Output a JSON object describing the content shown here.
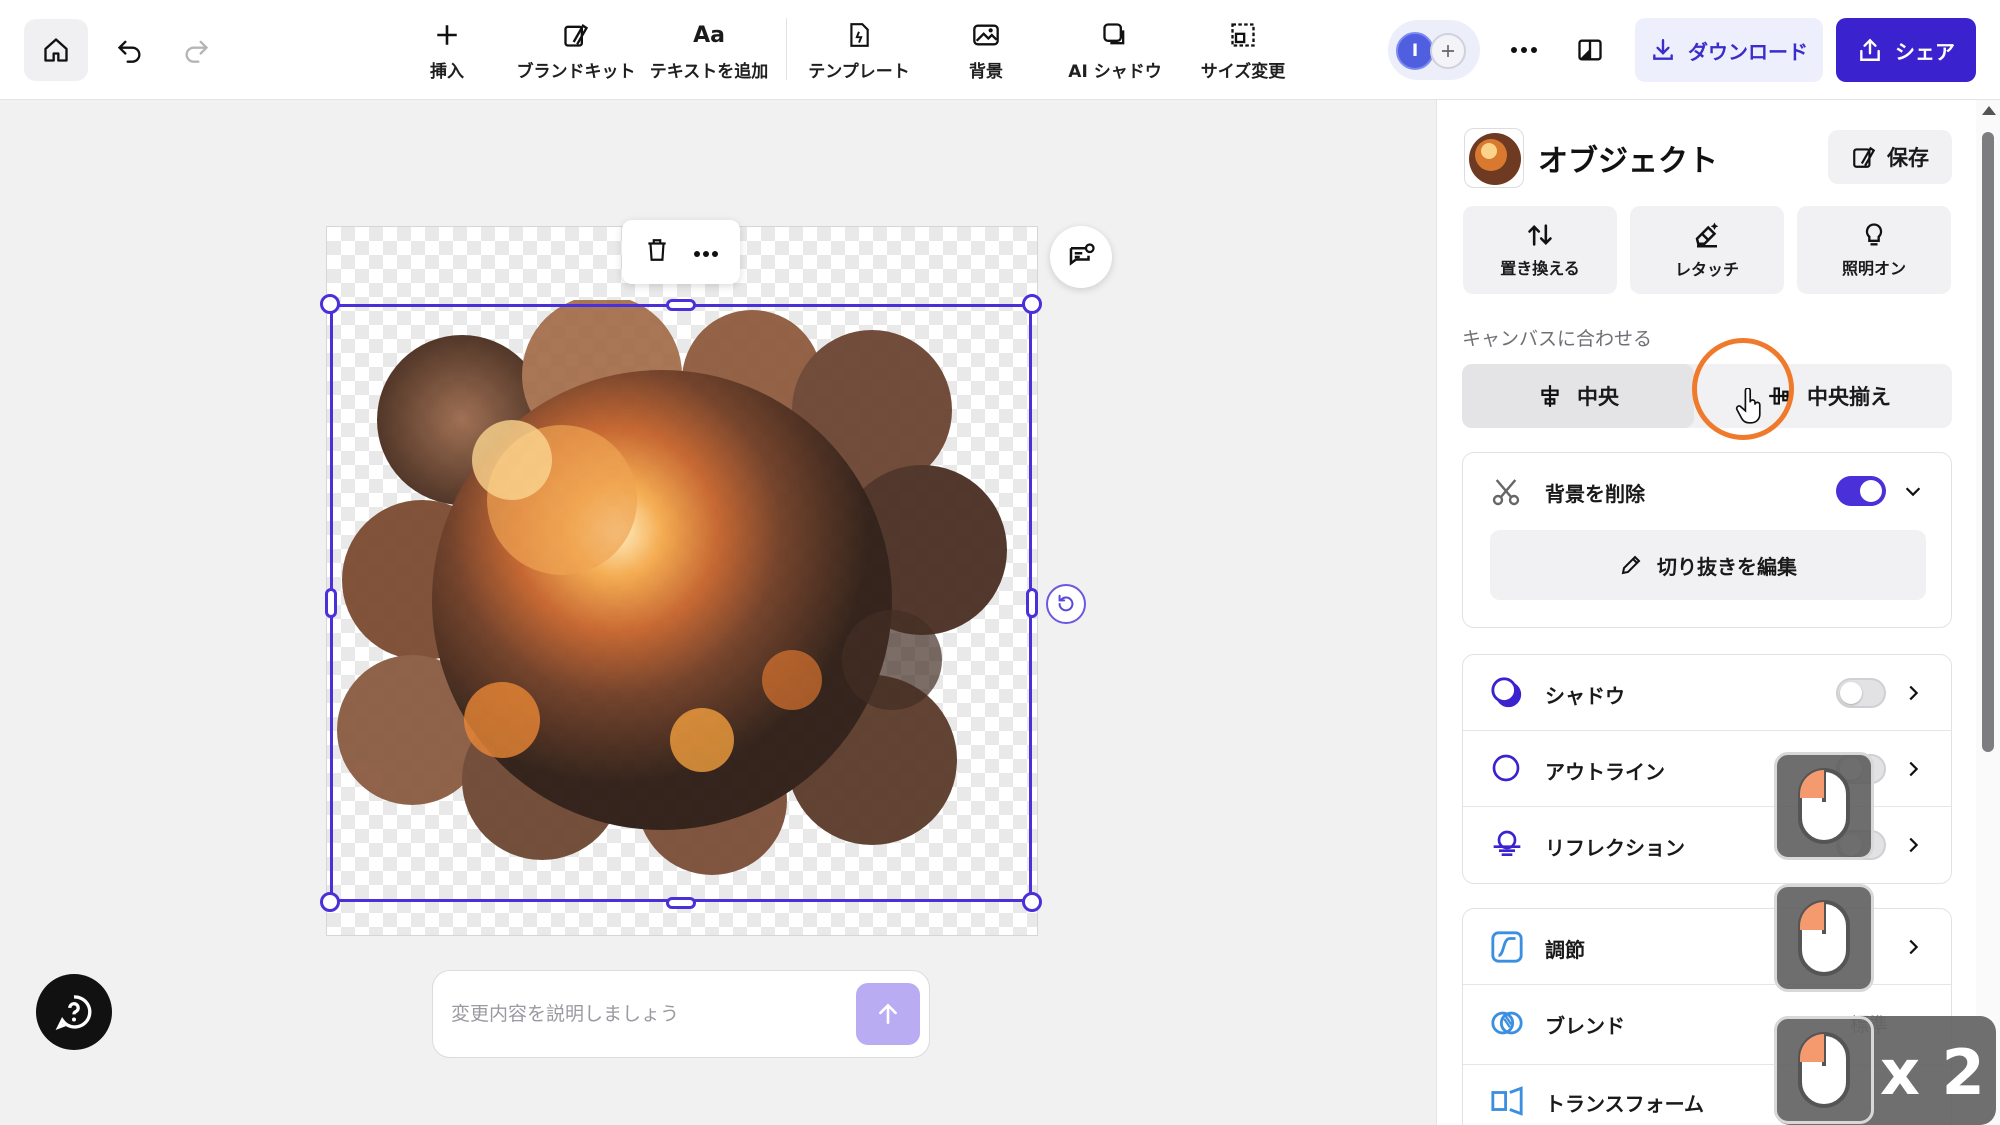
{
  "toolbar": {
    "tools": [
      {
        "label": "挿入",
        "icon": "plus-icon"
      },
      {
        "label": "ブランドキット",
        "icon": "brand-kit-icon"
      },
      {
        "label": "テキストを追加",
        "icon_text": "Aa"
      },
      {
        "label": "テンプレート",
        "icon": "template-icon"
      },
      {
        "label": "背景",
        "icon": "background-icon"
      },
      {
        "label": "AI シャドウ",
        "icon": "ai-shadow-icon"
      },
      {
        "label": "サイズ変更",
        "icon": "resize-icon"
      }
    ],
    "avatar_initial": "I",
    "download_label": "ダウンロード",
    "share_label": "シェア"
  },
  "canvas": {
    "prompt_placeholder": "変更内容を説明しましょう"
  },
  "panel": {
    "title": "オブジェクト",
    "save_label": "保存",
    "actions": [
      {
        "label": "置き換える",
        "icon": "replace-icon"
      },
      {
        "label": "レタッチ",
        "icon": "retouch-icon"
      },
      {
        "label": "照明オン",
        "icon": "light-bulb-icon"
      }
    ],
    "fit_canvas_label": "キャンバスに合わせる",
    "align_center_label": "中央",
    "align_middle_label": "中央揃え",
    "remove_bg": {
      "label": "背景を削除",
      "enabled": true,
      "edit_cutout_label": "切り抜きを編集"
    },
    "effects": [
      {
        "label": "シャドウ",
        "enabled": false
      },
      {
        "label": "アウトライン",
        "enabled": false
      },
      {
        "label": "リフレクション",
        "enabled": false
      }
    ],
    "adjust_label": "調節",
    "blend_label": "ブレンド",
    "blend_value": "標準",
    "transform_label": "トランスフォーム"
  },
  "overlay": {
    "multiplier": "x 2"
  },
  "colors": {
    "accent": "#4a30d9",
    "share_bg": "#3b22cf",
    "click_ring": "#f07a2c"
  }
}
